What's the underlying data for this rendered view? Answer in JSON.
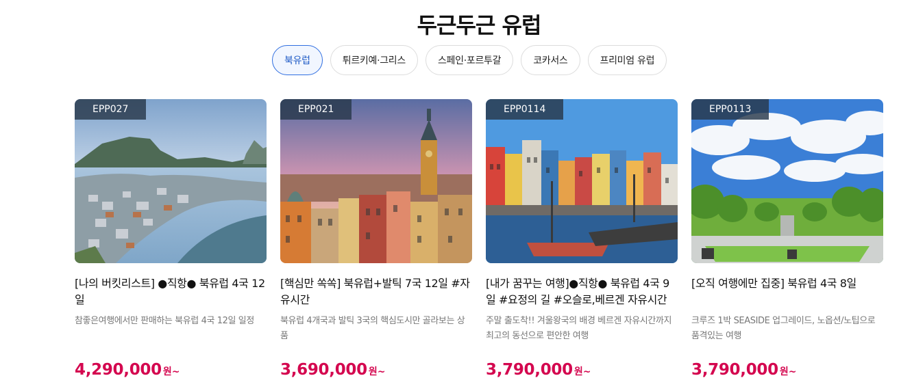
{
  "section": {
    "title": "두근두근 유럽"
  },
  "tabs": [
    {
      "label": "북유럽",
      "active": true
    },
    {
      "label": "튀르키예·그리스",
      "active": false
    },
    {
      "label": "스페인·포르투갈",
      "active": false
    },
    {
      "label": "코카서스",
      "active": false
    },
    {
      "label": "프리미엄 유럽",
      "active": false
    }
  ],
  "products": [
    {
      "code": "EPP027",
      "name": "[나의 버킷리스트] ●직항● 북유럽 4국 12일",
      "description": "참좋은여행에서만 판매하는 북유럽 4국 12일 일정",
      "price": "4,290,000",
      "price_unit": "원~"
    },
    {
      "code": "EPP021",
      "name": "[핵심만 쏙쏙] 북유럽+발틱 7국 12일 #자유시간",
      "description": "북유럽 4개국과 발틱 3국의 핵심도시만 골라보는 상품",
      "price": "3,690,000",
      "price_unit": "원~"
    },
    {
      "code": "EPP0114",
      "name": "[내가 꿈꾸는 여행]●직항● 북유럽 4국 9일 #요정의 길 #오슬로,베르겐 자유시간",
      "description": "주말 출도착!! 겨울왕국의 배경 베르겐 자유시간까지 최고의 동선으로 편안한 여행",
      "price": "3,790,000",
      "price_unit": "원~"
    },
    {
      "code": "EPP0113",
      "name": "[오직 여행에만 집중] 북유럽 4국 8일",
      "description": "크루즈 1박 SEASIDE 업그레이드, 노옵션/노팁으로 품격있는 여행",
      "price": "3,790,000",
      "price_unit": "원~"
    }
  ]
}
